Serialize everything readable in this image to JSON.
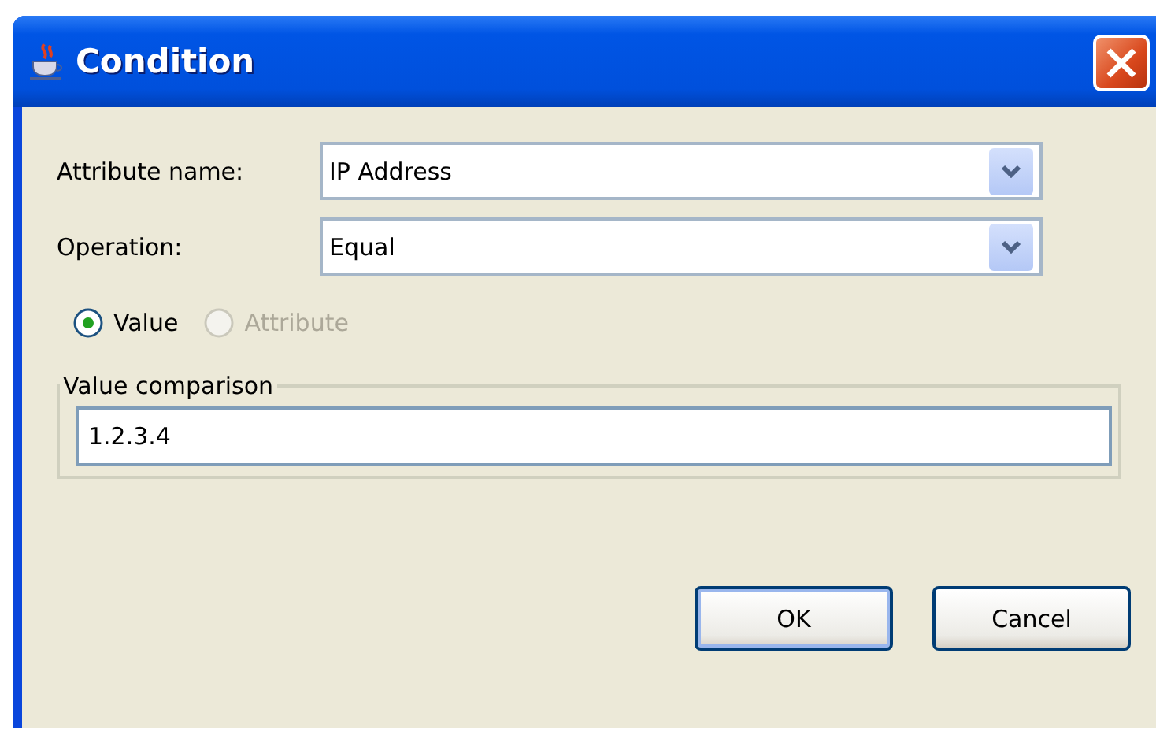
{
  "window": {
    "title": "Condition"
  },
  "fields": [
    {
      "label": "Attribute name:",
      "value": "IP Address"
    },
    {
      "label": "Operation:",
      "value": "Equal"
    }
  ],
  "radios": [
    {
      "label": "Value",
      "selected": true,
      "disabled": false
    },
    {
      "label": "Attribute",
      "selected": false,
      "disabled": true
    }
  ],
  "group": {
    "title": "Value comparison",
    "value": "1.2.3.4"
  },
  "buttons": [
    {
      "label": "OK",
      "default": true
    },
    {
      "label": "Cancel",
      "default": false
    }
  ]
}
